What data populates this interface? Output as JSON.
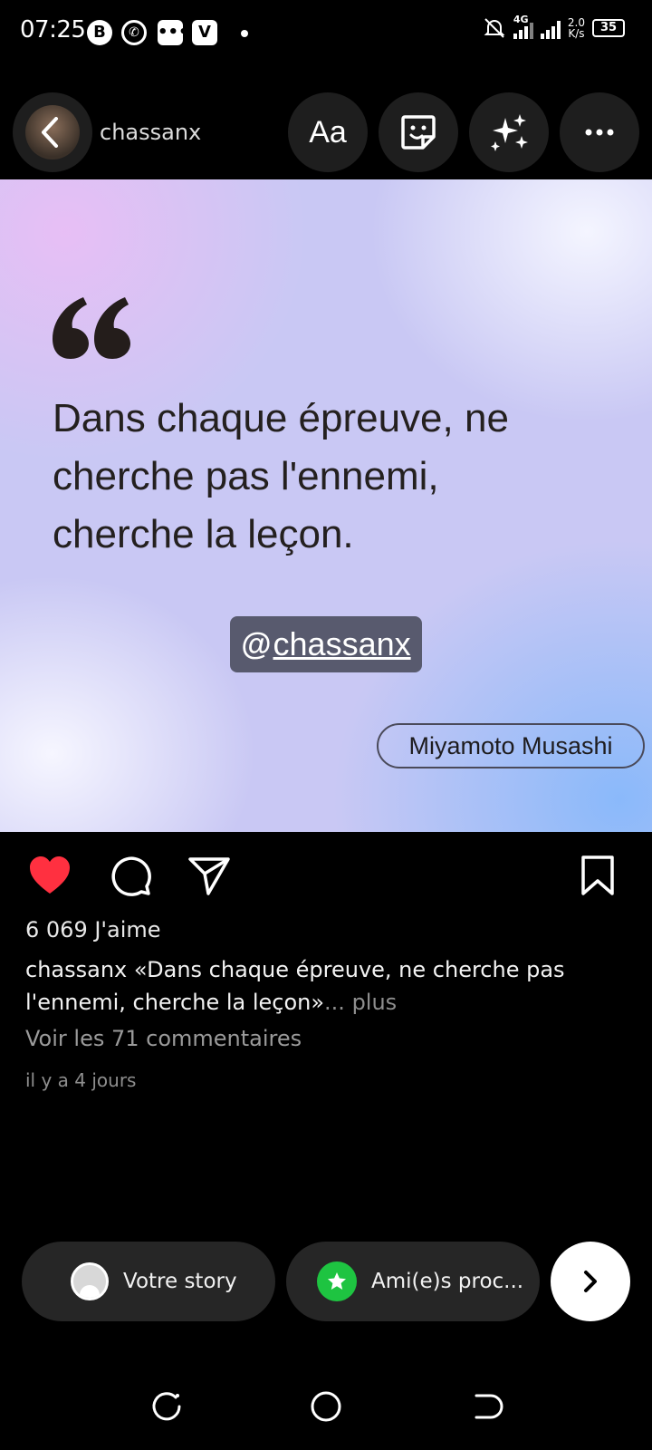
{
  "status_bar": {
    "time": "07:25",
    "network_type": "4G",
    "speed_value": "2.0",
    "speed_unit": "K/s",
    "battery_level": "35",
    "app_icons": [
      "b-icon",
      "whatsapp-icon",
      "chat-bubble-icon",
      "v-app-icon"
    ]
  },
  "story_header": {
    "username": "chassanx",
    "text_tool_label": "Aa"
  },
  "post": {
    "quote_lines": [
      "Dans chaque épreuve, ne",
      "cherche pas l'ennemi,",
      "cherche la leçon."
    ],
    "mention_at": "@",
    "mention_name": "chassanx",
    "author": "Miyamoto Musashi",
    "like_count_text": "6 069 J'aime",
    "caption_user": "chassanx",
    "caption_text": "«Dans chaque épreuve, ne cherche pas l'ennemi, cherche la leçon»",
    "caption_more": "... plus",
    "view_comments": "Voir les 71 commentaires",
    "timestamp": "il y a 4 jours",
    "liked": true
  },
  "share_bar": {
    "your_story_label": "Votre story",
    "close_friends_label": "Ami(e)s proc..."
  },
  "colors": {
    "like_red": "#ff3040",
    "close_friends_green": "#1ec441",
    "mention_sticker_bg": "#585a6e"
  }
}
